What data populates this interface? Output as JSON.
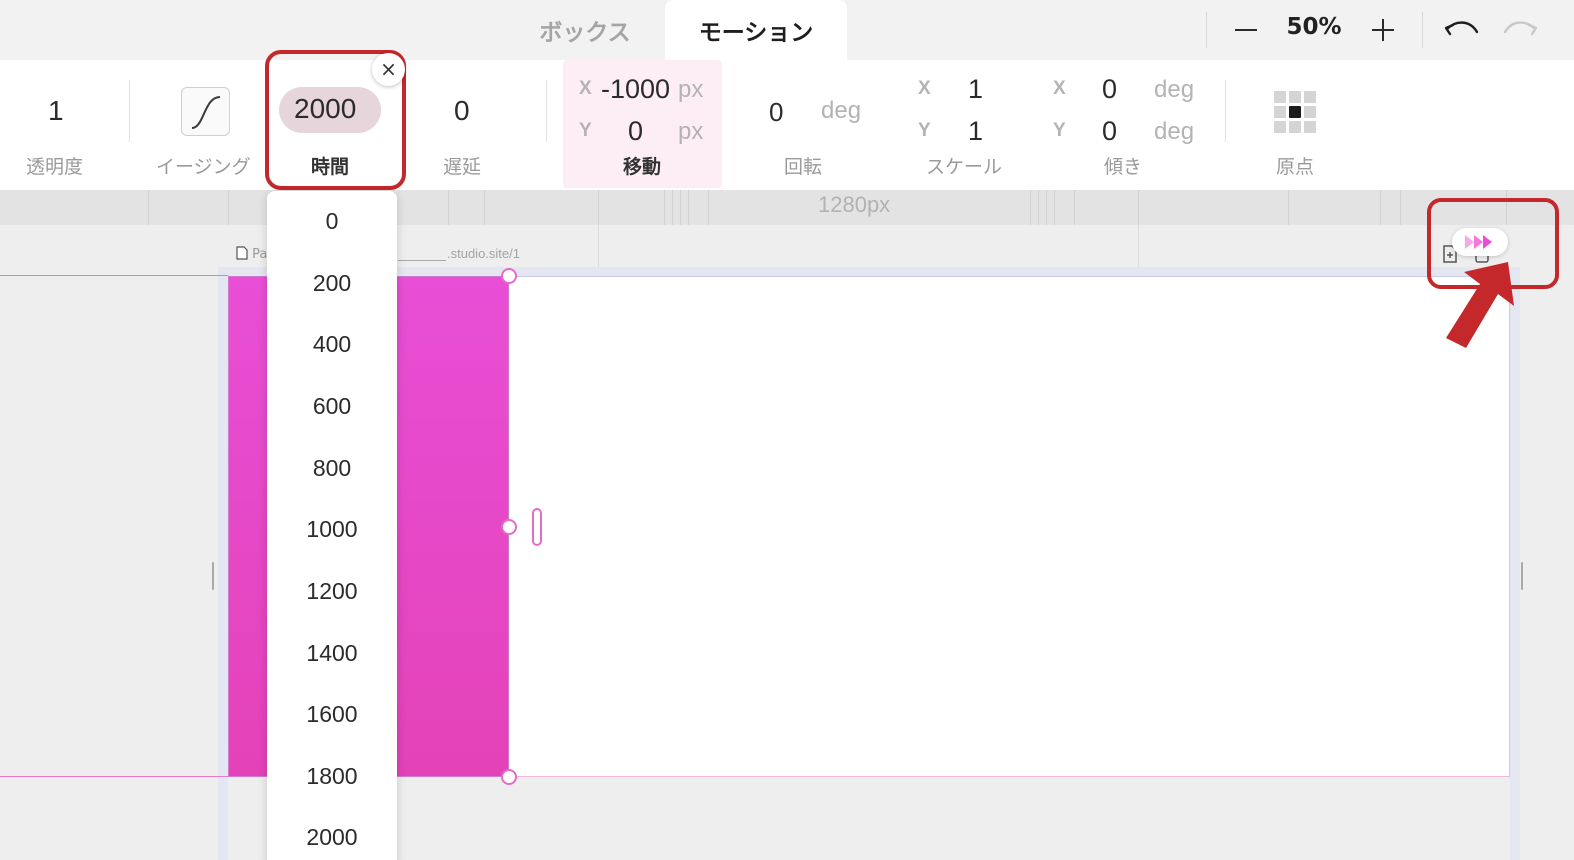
{
  "tabs": {
    "box": "ボックス",
    "motion": "モーション"
  },
  "zoom": {
    "value": "50%"
  },
  "toolbar": {
    "opacity": {
      "value": "1",
      "label": "透明度"
    },
    "easing": {
      "label": "イージング"
    },
    "duration": {
      "value": "2000",
      "label": "時間",
      "close": "×"
    },
    "delay": {
      "value": "0",
      "label": "遅延"
    },
    "translate": {
      "x_axis": "X",
      "x_value": "-1000",
      "x_unit": "px",
      "y_axis": "Y",
      "y_value": "0",
      "y_unit": "px",
      "label": "移動"
    },
    "rotate": {
      "value": "0",
      "unit": "deg",
      "label": "回転"
    },
    "scale": {
      "x_axis": "X",
      "x_value": "1",
      "y_axis": "Y",
      "y_value": "1",
      "label": "スケール"
    },
    "skew": {
      "x_axis": "X",
      "x_value": "0",
      "x_unit": "deg",
      "y_axis": "Y",
      "y_value": "0",
      "y_unit": "deg",
      "label": "傾き"
    },
    "origin": {
      "label": "原点"
    }
  },
  "canvas": {
    "ruler_label": "1280px",
    "page_label": "Pa",
    "page_url": ".studio.site/1"
  },
  "duration_options": [
    "0",
    "200",
    "400",
    "600",
    "800",
    "1000",
    "1200",
    "1400",
    "1600",
    "1800",
    "2000"
  ],
  "colors": {
    "accent_pink": "#e84fd6",
    "annotation_red": "#c4282b",
    "preview_icon": "#f06ad8"
  }
}
